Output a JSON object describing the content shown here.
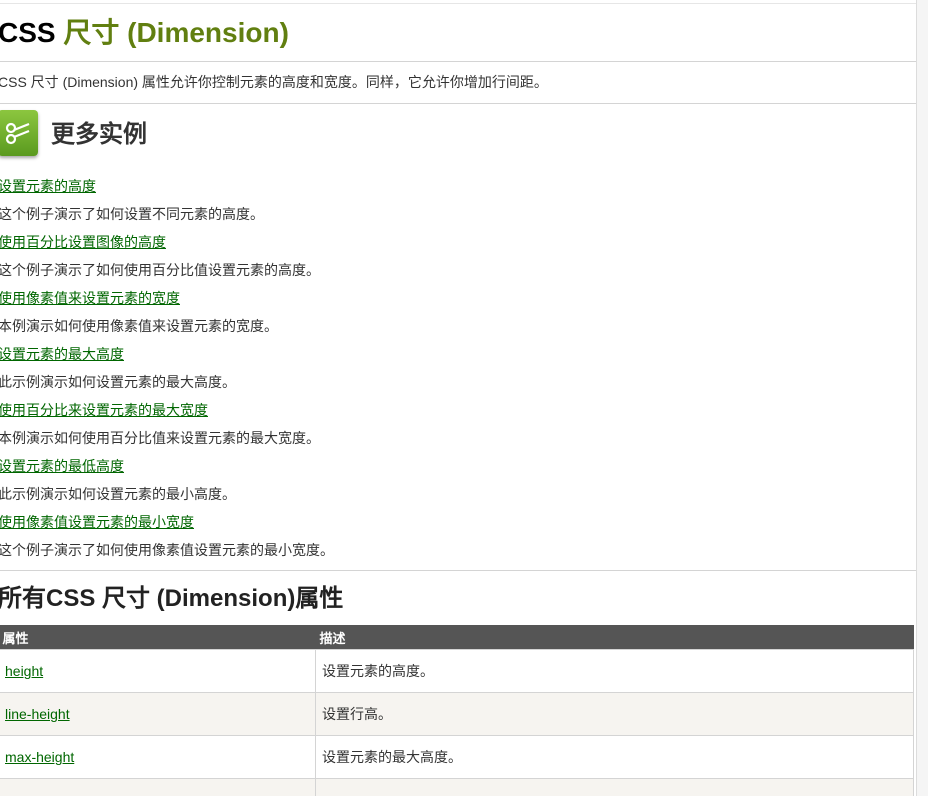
{
  "page": {
    "title_prefix": "CSS ",
    "title_main": "尺寸 (Dimension)",
    "intro": "CSS 尺寸 (Dimension) 属性允许你控制元素的高度和宽度。同样，它允许你增加行间距。"
  },
  "more": {
    "title": "更多实例",
    "icon": "scissors-icon",
    "examples": [
      {
        "link": "设置元素的高度",
        "desc": "这个例子演示了如何设置不同元素的高度。"
      },
      {
        "link": "使用百分比设置图像的高度",
        "desc": "这个例子演示了如何使用百分比值设置元素的高度。"
      },
      {
        "link": "使用像素值来设置元素的宽度",
        "desc": "本例演示如何使用像素值来设置元素的宽度。"
      },
      {
        "link": "设置元素的最大高度",
        "desc": "此示例演示如何设置元素的最大高度。"
      },
      {
        "link": "使用百分比来设置元素的最大宽度",
        "desc": "本例演示如何使用百分比值来设置元素的最大宽度。"
      },
      {
        "link": "设置元素的最低高度",
        "desc": "此示例演示如何设置元素的最小高度。"
      },
      {
        "link": "使用像素值设置元素的最小宽度",
        "desc": "这个例子演示了如何使用像素值设置元素的最小宽度。"
      }
    ]
  },
  "section": {
    "title": "所有CSS 尺寸 (Dimension)属性"
  },
  "table": {
    "headers": [
      "属性",
      "描述"
    ],
    "rows": [
      {
        "prop": "height",
        "desc": "设置元素的高度。"
      },
      {
        "prop": "line-height",
        "desc": "设置行高。"
      },
      {
        "prop": "max-height",
        "desc": "设置元素的最大高度。"
      },
      {
        "prop": "",
        "desc": ""
      }
    ]
  },
  "colors": {
    "title_green": "#617f10",
    "link": "#006600",
    "table_header": "#555555",
    "row_alt": "#f6f4f0"
  }
}
